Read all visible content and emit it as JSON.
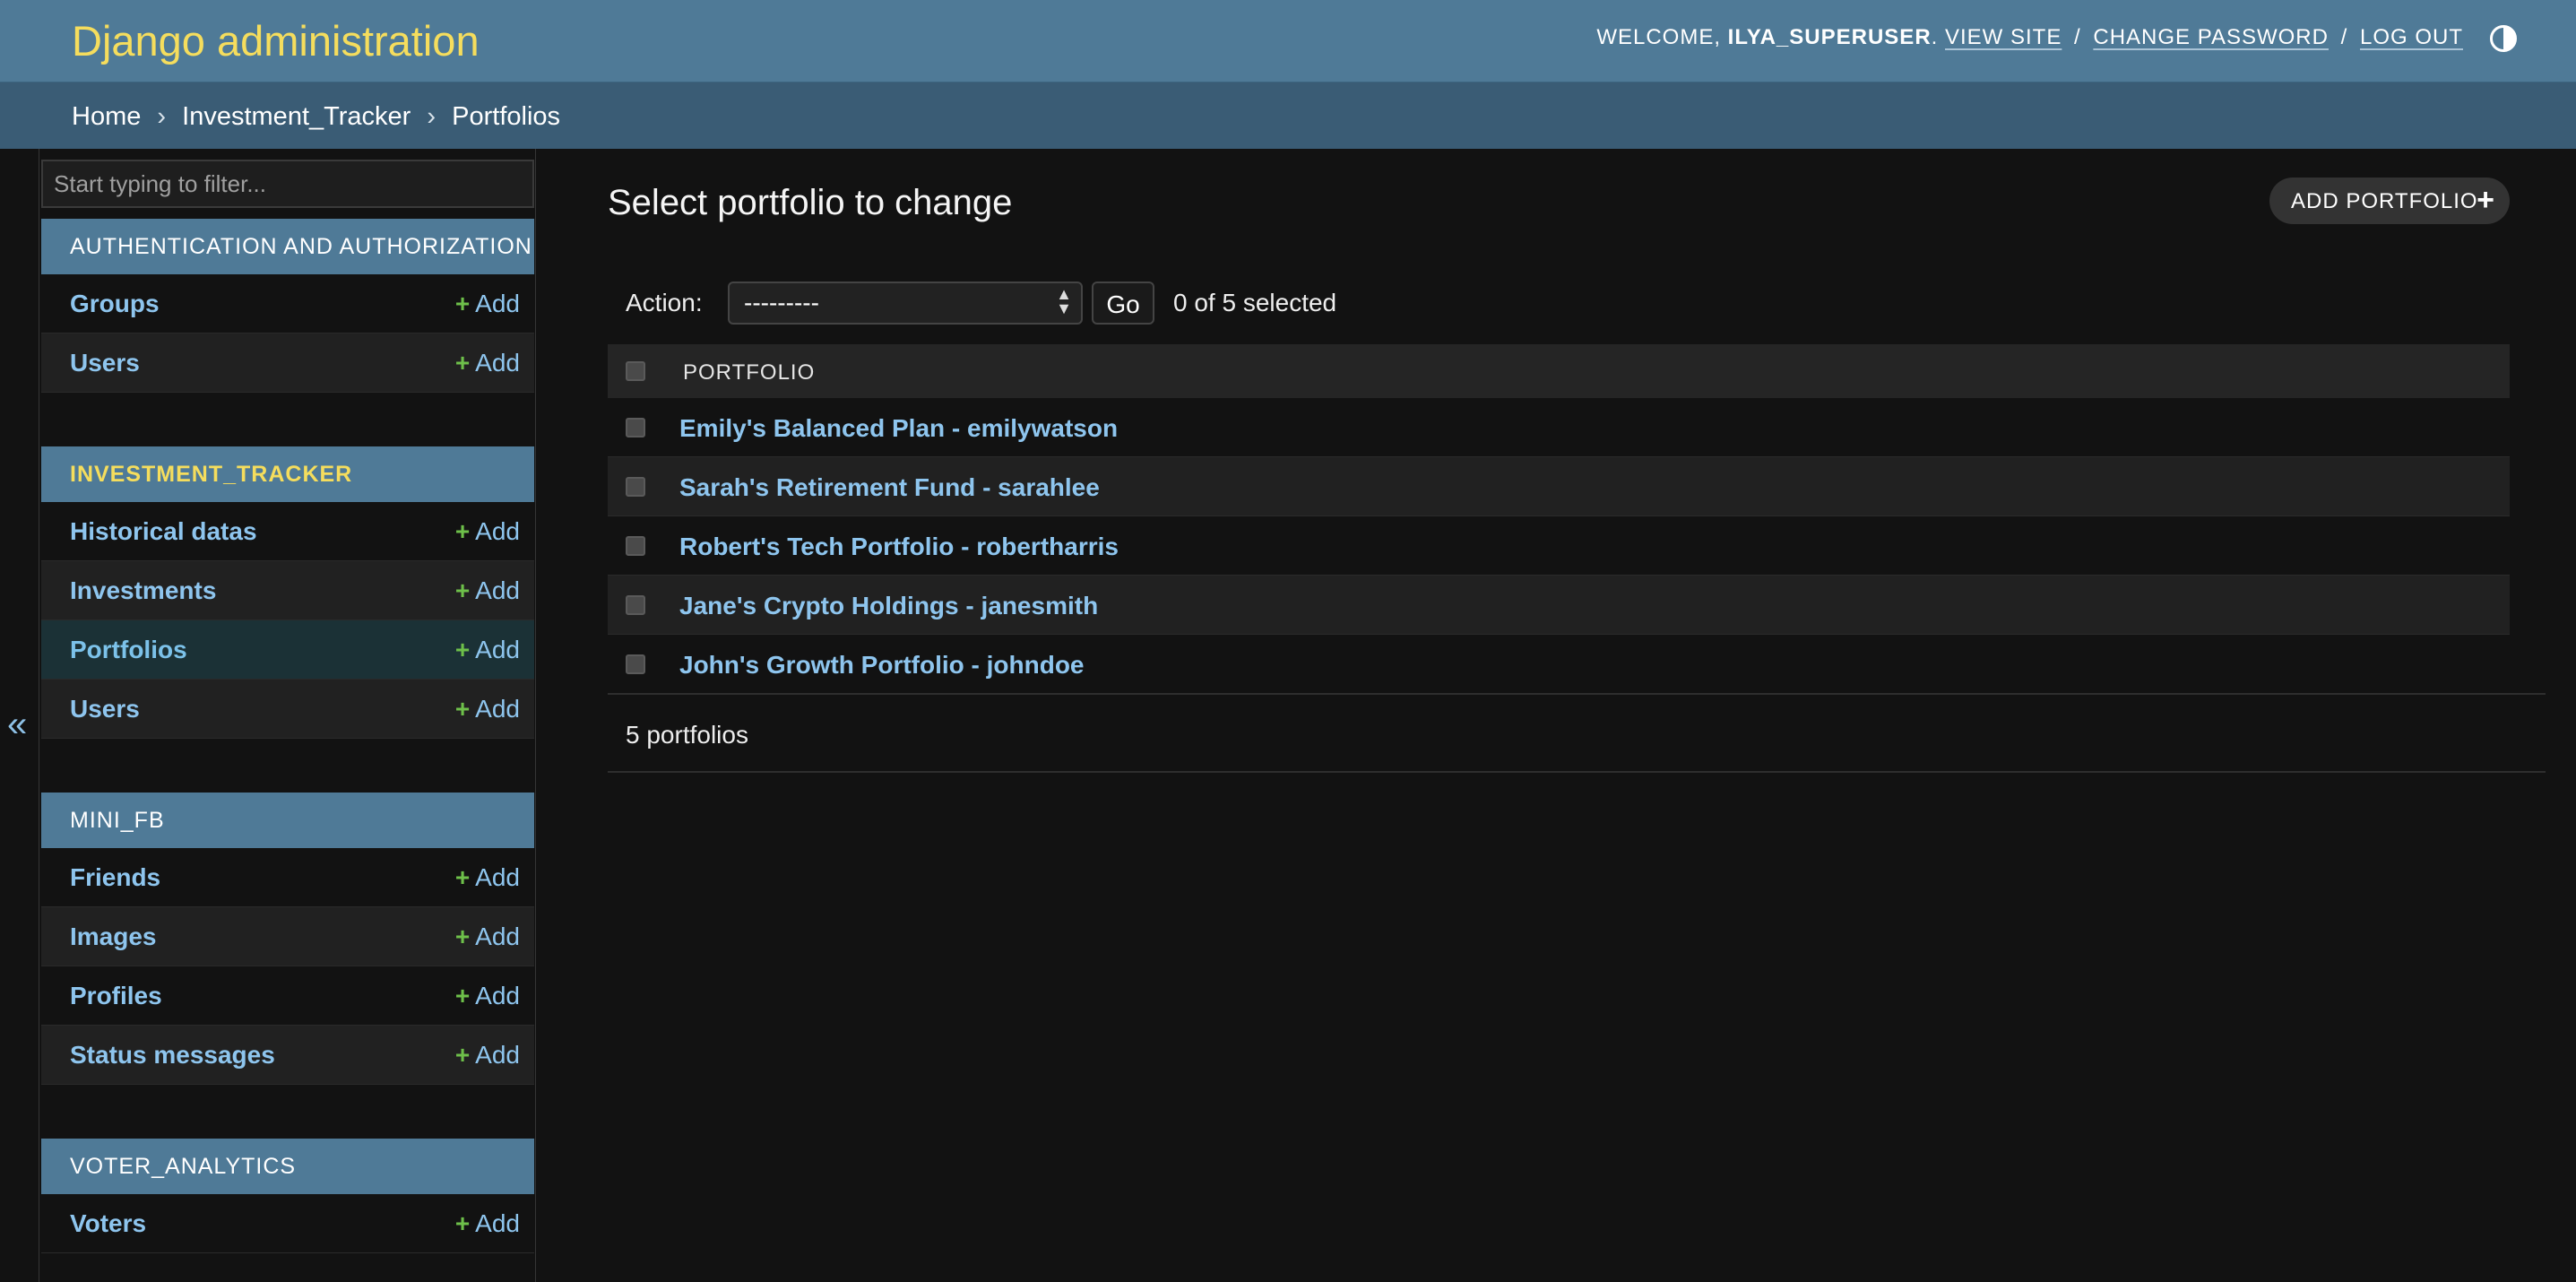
{
  "header": {
    "site_name": "Django administration",
    "welcome_text": "WELCOME,",
    "username": "ILYA_SUPERUSER",
    "view_site": "VIEW SITE",
    "change_password": "CHANGE PASSWORD",
    "log_out": "LOG OUT",
    "separator": "/"
  },
  "breadcrumbs": {
    "home": "Home",
    "app": "Investment_Tracker",
    "current": "Portfolios",
    "separator": "›"
  },
  "sidebar": {
    "filter_placeholder": "Start typing to filter...",
    "collapse_icon": "«",
    "add_label": "Add",
    "add_icon": "+",
    "modules": [
      {
        "caption": "AUTHENTICATION AND AUTHORIZATION",
        "models": [
          "Groups",
          "Users"
        ]
      },
      {
        "caption": "INVESTMENT_TRACKER",
        "models": [
          "Historical datas",
          "Investments",
          "Portfolios",
          "Users"
        ]
      },
      {
        "caption": "MINI_FB",
        "models": [
          "Friends",
          "Images",
          "Profiles",
          "Status messages"
        ]
      },
      {
        "caption": "VOTER_ANALYTICS",
        "models": [
          "Voters"
        ]
      }
    ]
  },
  "content": {
    "title": "Select portfolio to change",
    "add_button": "ADD PORTFOLIO",
    "add_icon": "+",
    "action_label": "Action:",
    "action_selected": "---------",
    "go_button": "Go",
    "selection_count": "0 of 5 selected",
    "column_header": "PORTFOLIO",
    "rows": [
      "Emily's Balanced Plan - emilywatson",
      "Sarah's Retirement Fund - sarahlee",
      "Robert's Tech Portfolio - robertharris",
      "Jane's Crypto Holdings - janesmith",
      "John's Growth Portfolio - johndoe"
    ],
    "paginator": "5 portfolios"
  },
  "colors": {
    "header_bg": "#4f7a97",
    "breadcrumb_bg": "#3a5c75",
    "brand_yellow": "#f5dd5d",
    "link_blue": "#8ec5ee",
    "add_green": "#6ec04a"
  }
}
